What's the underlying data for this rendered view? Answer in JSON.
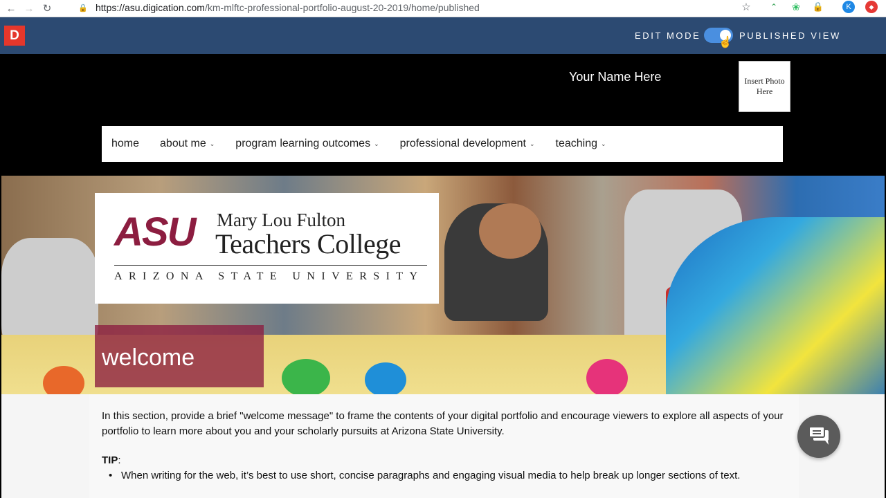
{
  "browser": {
    "url_host": "https://asu.digication.com",
    "url_path": "/km-mlftc-professional-portfolio-august-20-2019/home/published",
    "ext_k_label": "K"
  },
  "digication": {
    "logo_letter": "D",
    "edit_mode_label": "EDIT MODE",
    "published_view_label": "PUBLISHED VIEW"
  },
  "header": {
    "name": "Your Name Here",
    "photo_placeholder": "Insert Photo Here"
  },
  "nav": {
    "items": [
      {
        "label": "home",
        "has_dropdown": false
      },
      {
        "label": "about me",
        "has_dropdown": true
      },
      {
        "label": "program learning outcomes",
        "has_dropdown": true
      },
      {
        "label": "professional development",
        "has_dropdown": true
      },
      {
        "label": "teaching",
        "has_dropdown": true
      }
    ]
  },
  "banner": {
    "logo": {
      "asu": "ASU",
      "line1": "Mary Lou Fulton",
      "line2": "Teachers College",
      "line3": "ARIZONA STATE UNIVERSITY"
    },
    "title": "welcome"
  },
  "content": {
    "intro": "In this section, provide a brief  \"welcome message\" to frame the contents of your digital portfolio and encourage viewers to explore all aspects of your portfolio to learn more about you and your scholarly pursuits at Arizona State University.",
    "tip_label": "TIP",
    "tip_suffix": ":",
    "bullet": "When writing for the web, it’s best to use short, concise paragraphs and engaging visual media to help break up longer sections of text."
  },
  "colors": {
    "topbar": "#2c4a72",
    "asu_maroon": "#8c1d40",
    "asu_gold": "#ffc627",
    "toggle": "#4a8fe0"
  },
  "icons": [
    "back-icon",
    "forward-icon",
    "reload-icon",
    "lock-icon",
    "star-icon",
    "chat-icon"
  ]
}
